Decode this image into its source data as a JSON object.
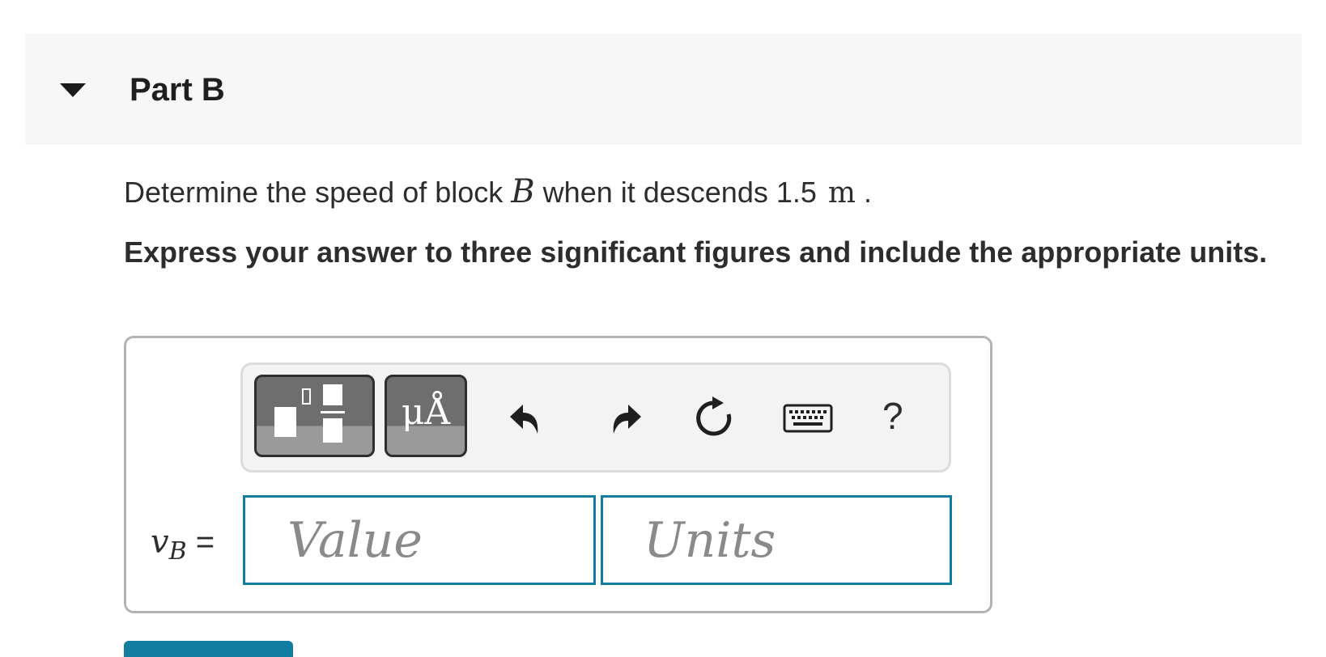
{
  "part": {
    "title": "Part B",
    "expanded": true
  },
  "question": {
    "prefix": "Determine the speed of block ",
    "variable": "B",
    "middle": " when it descends 1.5",
    "unit": "m",
    "suffix": " ."
  },
  "instruction": "Express your answer to three significant figures and include the appropriate units.",
  "toolbar": {
    "buttons": [
      "templates-icon",
      "units-icon",
      "undo-icon",
      "redo-icon",
      "reset-icon",
      "keyboard-icon",
      "help-icon"
    ],
    "units_glyph": "μÅ",
    "help_label": "?"
  },
  "answer": {
    "variable": "v",
    "subscript": "B",
    "equals": " =",
    "value_placeholder": "Value",
    "units_placeholder": "Units",
    "value": "",
    "units": ""
  },
  "colors": {
    "accent": "#137da0",
    "header_bg": "#f7f7f7",
    "button_dark": "#6e6e6e"
  }
}
